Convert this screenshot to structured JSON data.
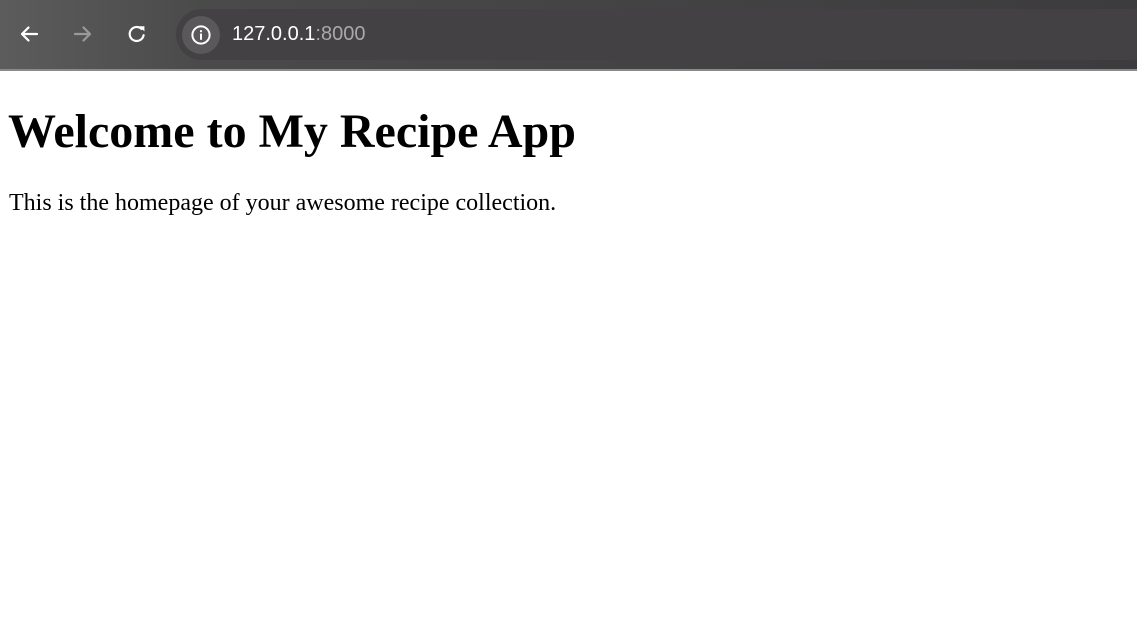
{
  "browser": {
    "address_bar": {
      "host": "127.0.0.1",
      "port": ":8000"
    },
    "icons": {
      "back": "arrow-left-icon",
      "forward": "arrow-right-icon",
      "reload": "reload-icon",
      "site_info": "info-icon"
    },
    "forward_enabled": false
  },
  "page": {
    "heading": "Welcome to My Recipe App",
    "paragraph": "This is the homepage of your awesome recipe collection."
  }
}
